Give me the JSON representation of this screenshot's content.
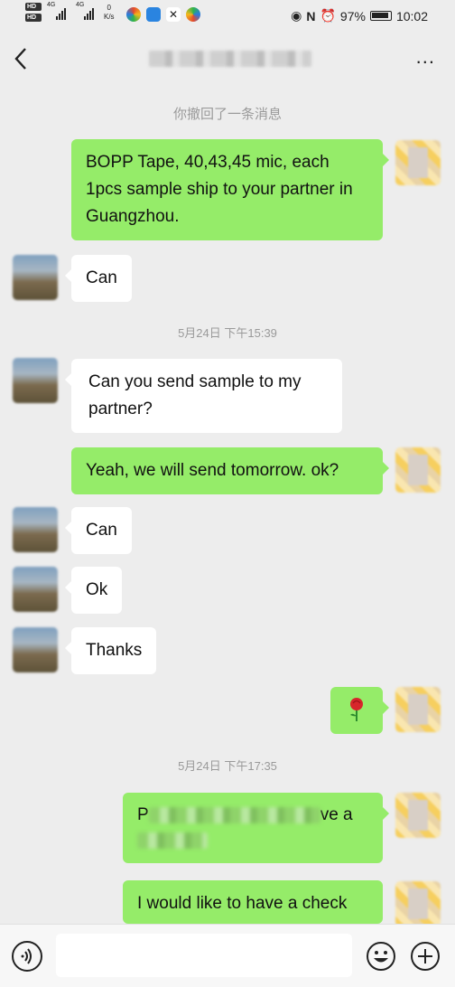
{
  "status_bar": {
    "hd_1": "HD",
    "hd_2": "HD",
    "net_1": "4G",
    "net_2": "4G",
    "speed_value": "0",
    "speed_unit": "K/s",
    "battery": "97%",
    "time": "10:02"
  },
  "header": {
    "title": "",
    "more": "..."
  },
  "messages": [
    {
      "type": "system",
      "text": "你撤回了一条消息"
    },
    {
      "type": "out",
      "text": "BOPP Tape, 40,43,45 mic, each 1pcs sample ship to your partner in Guangzhou."
    },
    {
      "type": "in",
      "text": "Can"
    },
    {
      "type": "timestamp",
      "text": "5月24日 下午15:39"
    },
    {
      "type": "in",
      "text": "Can you send sample to my partner?"
    },
    {
      "type": "out",
      "text": "Yeah, we will send tomorrow. ok?"
    },
    {
      "type": "in",
      "text": "Can"
    },
    {
      "type": "in",
      "text": "Ok"
    },
    {
      "type": "in",
      "text": "Thanks"
    },
    {
      "type": "out",
      "text": "",
      "emoji": "rose"
    },
    {
      "type": "timestamp",
      "text": "5月24日 下午17:35"
    },
    {
      "type": "out",
      "text_start": "P",
      "text_end": "ve a"
    },
    {
      "type": "out",
      "text": "I would like to have a check"
    }
  ],
  "input": {
    "value": "",
    "voice_icon": "voice-icon",
    "emoji_icon": "smiley-icon",
    "plus_icon": "plus-icon"
  },
  "colors": {
    "background": "#ededed",
    "outgoing_bubble": "#95ec69",
    "incoming_bubble": "#ffffff",
    "system_text": "#9a9a9a"
  }
}
